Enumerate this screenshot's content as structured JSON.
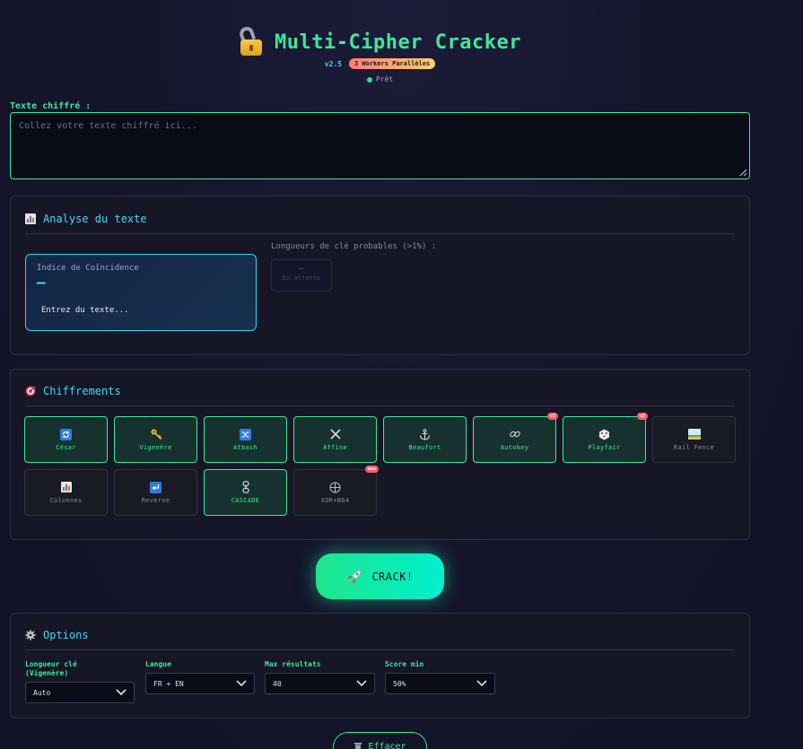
{
  "header": {
    "title": "Multi-Cipher Cracker",
    "version": "v2.5",
    "workers_badge": "3 Workers Parallèles",
    "status": "Prêt"
  },
  "input": {
    "label": "Texte chiffré :",
    "placeholder": "Collez votre texte chiffré ici...",
    "value": ""
  },
  "analysis": {
    "title": "Analyse du texte",
    "ic_label": "Indice de Coïncidence",
    "ic_value": "—",
    "ic_hint": "Entrez du texte...",
    "keylen_label": "Longueurs de clé probables (>1%) :",
    "keylen_dash": "—",
    "keylen_wait": "En attente"
  },
  "ciphers": {
    "title": "Chiffrements",
    "items": [
      {
        "label": "César",
        "icon": "refresh-icon",
        "active": true,
        "badge": ""
      },
      {
        "label": "Vigenère",
        "icon": "key-icon",
        "active": true,
        "badge": ""
      },
      {
        "label": "Atbash",
        "icon": "shuffle-icon",
        "active": true,
        "badge": ""
      },
      {
        "label": "Affine",
        "icon": "cross-icon",
        "active": true,
        "badge": ""
      },
      {
        "label": "Beaufort",
        "icon": "anchor-icon",
        "active": true,
        "badge": ""
      },
      {
        "label": "Autokey",
        "icon": "link-icon",
        "active": true,
        "badge": "v2"
      },
      {
        "label": "Playfair",
        "icon": "dice-icon",
        "active": true,
        "badge": "v2"
      },
      {
        "label": "Rail Fence",
        "icon": "rail-icon",
        "active": false,
        "badge": ""
      },
      {
        "label": "Colonnes",
        "icon": "bar-chart-icon",
        "active": false,
        "badge": ""
      },
      {
        "label": "Reverse",
        "icon": "return-icon",
        "active": false,
        "badge": ""
      },
      {
        "label": "CASCADE",
        "icon": "chain-icon",
        "active": true,
        "badge": ""
      },
      {
        "label": "XOR+B64",
        "icon": "crosshair-icon",
        "active": false,
        "badge": "new"
      }
    ]
  },
  "crack": {
    "label": "CRACK!"
  },
  "options": {
    "title": "Options",
    "key_length_label": "Longueur clé (Vigenère)",
    "key_length_value": "Auto",
    "language_label": "Langue",
    "language_value": "FR + EN",
    "max_results_label": "Max résultats",
    "max_results_value": "40",
    "min_score_label": "Score min",
    "min_score_value": "50%"
  },
  "clear": {
    "label": "Effacer"
  },
  "colors": {
    "accent_green": "#3ee89a",
    "accent_cyan": "#46d9f0",
    "badge_red": "#ff5a6a"
  }
}
